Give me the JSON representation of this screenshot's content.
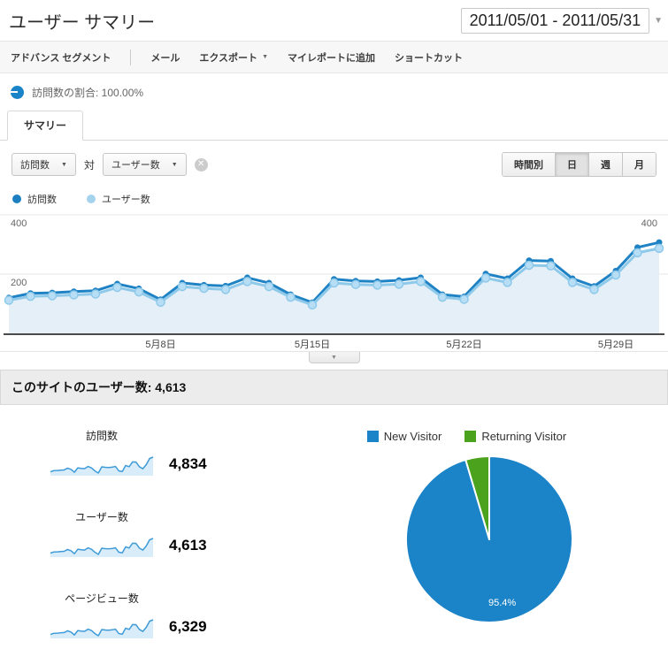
{
  "header": {
    "title": "ユーザー サマリー",
    "date_range": "2011/05/01 - 2011/05/31"
  },
  "toolbar": {
    "items": [
      "アドバンス セグメント",
      "メール",
      "エクスポート",
      "マイレポートに追加",
      "ショートカット"
    ]
  },
  "segment": {
    "ratio_text": "訪問数の割合: 100.00%",
    "color": "#1b83c7"
  },
  "tabs": {
    "summary": "サマリー"
  },
  "controls": {
    "metric_a": "訪問数",
    "vs": "対",
    "metric_b": "ユーザー数",
    "granularity": [
      "時間別",
      "日",
      "週",
      "月"
    ],
    "granularity_selected": "日"
  },
  "chart_legend": [
    {
      "label": "訪問数",
      "color": "#1b7fc2"
    },
    {
      "label": "ユーザー数",
      "color": "#a5d3ee"
    }
  ],
  "chart_data": {
    "type": "line",
    "x_range": "2011/05/01 - 2011/05/31",
    "x_unit": "day",
    "x_ticks": [
      {
        "day": 8,
        "label": "5月8日"
      },
      {
        "day": 15,
        "label": "5月15日"
      },
      {
        "day": 22,
        "label": "5月22日"
      },
      {
        "day": 29,
        "label": "5月29日"
      }
    ],
    "ylim": [
      0,
      400
    ],
    "yticks": [
      200,
      400
    ],
    "grid": "horizontal",
    "legend_position": "top-left",
    "series": [
      {
        "name": "訪問数",
        "color": "#1e82c4",
        "values": [
          120,
          135,
          137,
          141,
          144,
          167,
          151,
          114,
          170,
          163,
          160,
          188,
          170,
          131,
          104,
          183,
          177,
          175,
          179,
          188,
          131,
          124,
          201,
          185,
          246,
          244,
          185,
          159,
          211,
          290,
          307
        ]
      },
      {
        "name": "ユーザー数",
        "color": "#8ec9ea",
        "marker_color": "#b7def5",
        "area_color": "#e4eff8",
        "values": [
          112,
          125,
          127,
          130,
          133,
          155,
          140,
          105,
          158,
          152,
          148,
          175,
          158,
          122,
          96,
          170,
          165,
          163,
          166,
          175,
          122,
          115,
          187,
          172,
          230,
          228,
          172,
          148,
          197,
          272,
          287
        ]
      }
    ]
  },
  "section": {
    "site_users": "このサイトのユーザー数: 4,613"
  },
  "metrics": [
    {
      "label": "訪問数",
      "value": "4,834",
      "spark": [
        120,
        135,
        137,
        141,
        144,
        167,
        151,
        114,
        170,
        163,
        160,
        188,
        170,
        131,
        104,
        183,
        177,
        175,
        179,
        188,
        131,
        124,
        201,
        185,
        246,
        244,
        185,
        159,
        211,
        290,
        307
      ]
    },
    {
      "label": "ユーザー数",
      "value": "4,613",
      "spark": [
        112,
        125,
        127,
        130,
        133,
        155,
        140,
        105,
        158,
        152,
        148,
        175,
        158,
        122,
        96,
        170,
        165,
        163,
        166,
        175,
        122,
        115,
        187,
        172,
        230,
        228,
        172,
        148,
        197,
        272,
        287
      ]
    },
    {
      "label": "ページビュー数",
      "value": "6,329",
      "spark": [
        157,
        177,
        179,
        185,
        189,
        219,
        198,
        149,
        223,
        214,
        210,
        246,
        223,
        172,
        136,
        240,
        232,
        229,
        235,
        246,
        172,
        162,
        263,
        242,
        322,
        320,
        242,
        208,
        276,
        380,
        402
      ]
    }
  ],
  "pie": {
    "type": "pie",
    "legend": [
      {
        "label": "New Visitor",
        "color": "#1b83c7"
      },
      {
        "label": "Returning Visitor",
        "color": "#4ba21d"
      }
    ],
    "slices": [
      {
        "label": "New Visitor",
        "pct": 95.4,
        "color": "#1b83c7"
      },
      {
        "label": "Returning Visitor",
        "pct": 4.6,
        "color": "#4ba21d"
      }
    ],
    "inner_label": "95.4%"
  }
}
